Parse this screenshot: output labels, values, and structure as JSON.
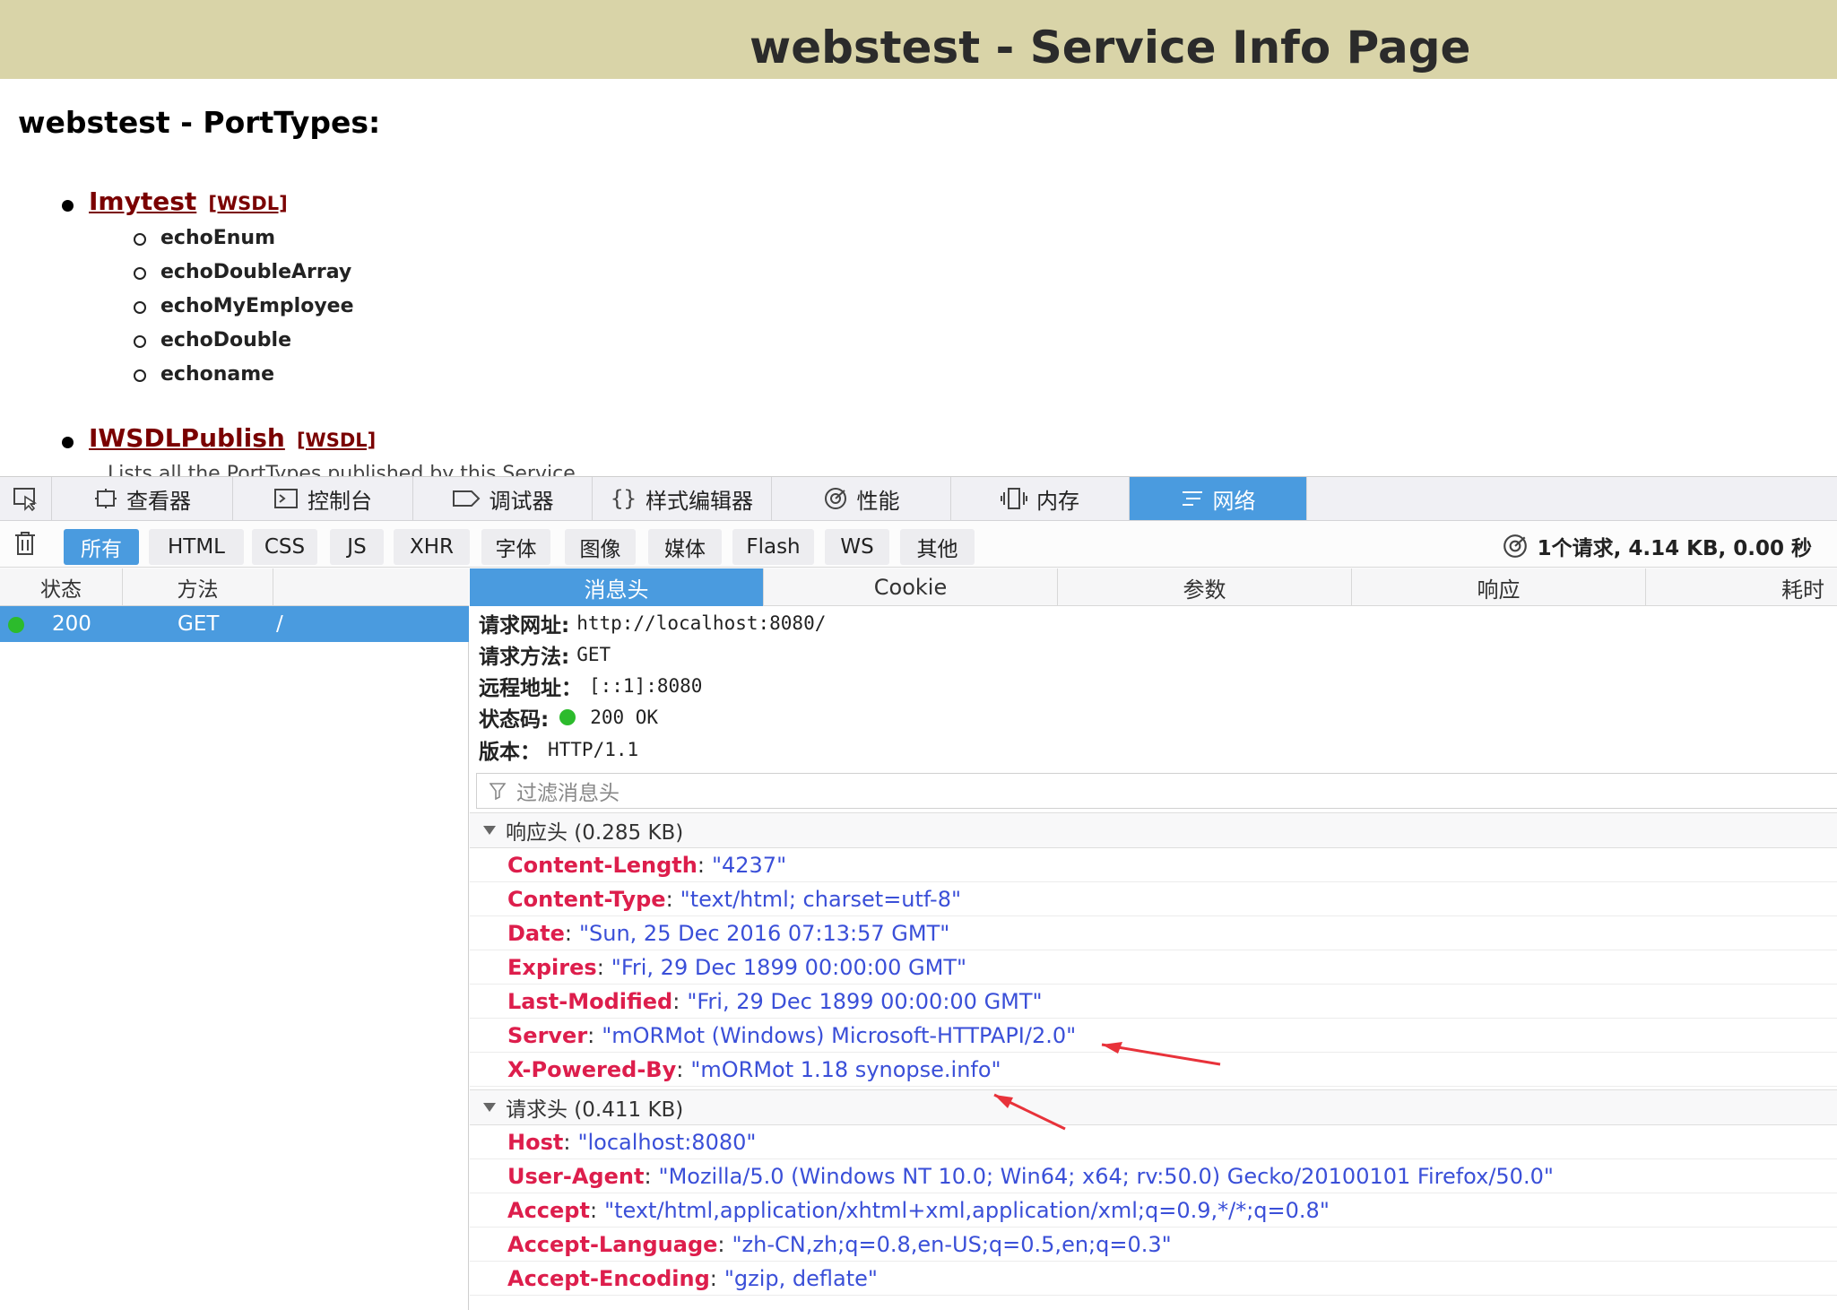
{
  "page": {
    "title": "webstest - Service Info Page",
    "section_title": "webstest - PortTypes:",
    "port_types": [
      {
        "name": "Imytest",
        "wsdl": "[WSDL]",
        "methods": [
          "echoEnum",
          "echoDoubleArray",
          "echoMyEmployee",
          "echoDouble",
          "echoname"
        ]
      },
      {
        "name": "IWSDLPublish",
        "wsdl": "[WSDL]",
        "description": "Lists all the PortTypes published by this Service"
      }
    ]
  },
  "devtools": {
    "tabs": [
      "查看器",
      "控制台",
      "调试器",
      "样式编辑器",
      "性能",
      "内存",
      "网络"
    ],
    "active_tab": "网络",
    "filters": [
      "所有",
      "HTML",
      "CSS",
      "JS",
      "XHR",
      "字体",
      "图像",
      "媒体",
      "Flash",
      "WS",
      "其他"
    ],
    "summary": "1个请求, 4.14 KB, 0.00 秒",
    "request_list": {
      "columns": {
        "status": "状态",
        "method": "方法"
      },
      "rows": [
        {
          "status": "200",
          "method": "GET",
          "file": "/"
        }
      ]
    },
    "detail_tabs": [
      "消息头",
      "Cookie",
      "参数",
      "响应",
      "耗时"
    ],
    "request_summary": [
      {
        "label": "请求网址:",
        "value": "http://localhost:8080/"
      },
      {
        "label": "请求方法:",
        "value": "GET"
      },
      {
        "label": "远程地址：",
        "value": "[::1]:8080"
      },
      {
        "label": "状态码:",
        "value": "200 OK"
      },
      {
        "label": "版本：",
        "value": "HTTP/1.1"
      }
    ],
    "filter_placeholder": "过滤消息头",
    "response_headers_title": "响应头 (0.285 KB)",
    "response_headers": [
      {
        "name": "Content-Length",
        "value": "\"4237\""
      },
      {
        "name": "Content-Type",
        "value": "\"text/html; charset=utf-8\""
      },
      {
        "name": "Date",
        "value": "\"Sun, 25 Dec 2016 07:13:57 GMT\""
      },
      {
        "name": "Expires",
        "value": "\"Fri, 29 Dec 1899 00:00:00 GMT\""
      },
      {
        "name": "Last-Modified",
        "value": "\"Fri, 29 Dec 1899 00:00:00 GMT\""
      },
      {
        "name": "Server",
        "value": "\"mORMot (Windows) Microsoft-HTTPAPI/2.0\""
      },
      {
        "name": "X-Powered-By",
        "value": "\"mORMot 1.18 synopse.info\""
      }
    ],
    "request_headers_title": "请求头 (0.411 KB)",
    "request_headers": [
      {
        "name": "Host",
        "value": "\"localhost:8080\""
      },
      {
        "name": "User-Agent",
        "value": "\"Mozilla/5.0 (Windows NT 10.0; Win64; x64; rv:50.0) Gecko/20100101 Firefox/50.0\""
      },
      {
        "name": "Accept",
        "value": "\"text/html,application/xhtml+xml,application/xml;q=0.9,*/*;q=0.8\""
      },
      {
        "name": "Accept-Language",
        "value": "\"zh-CN,zh;q=0.8,en-US;q=0.5,en;q=0.3\""
      },
      {
        "name": "Accept-Encoding",
        "value": "\"gzip, deflate\""
      }
    ],
    "annotation_color": "#e8323a",
    "accent": "#4a9bdf"
  }
}
